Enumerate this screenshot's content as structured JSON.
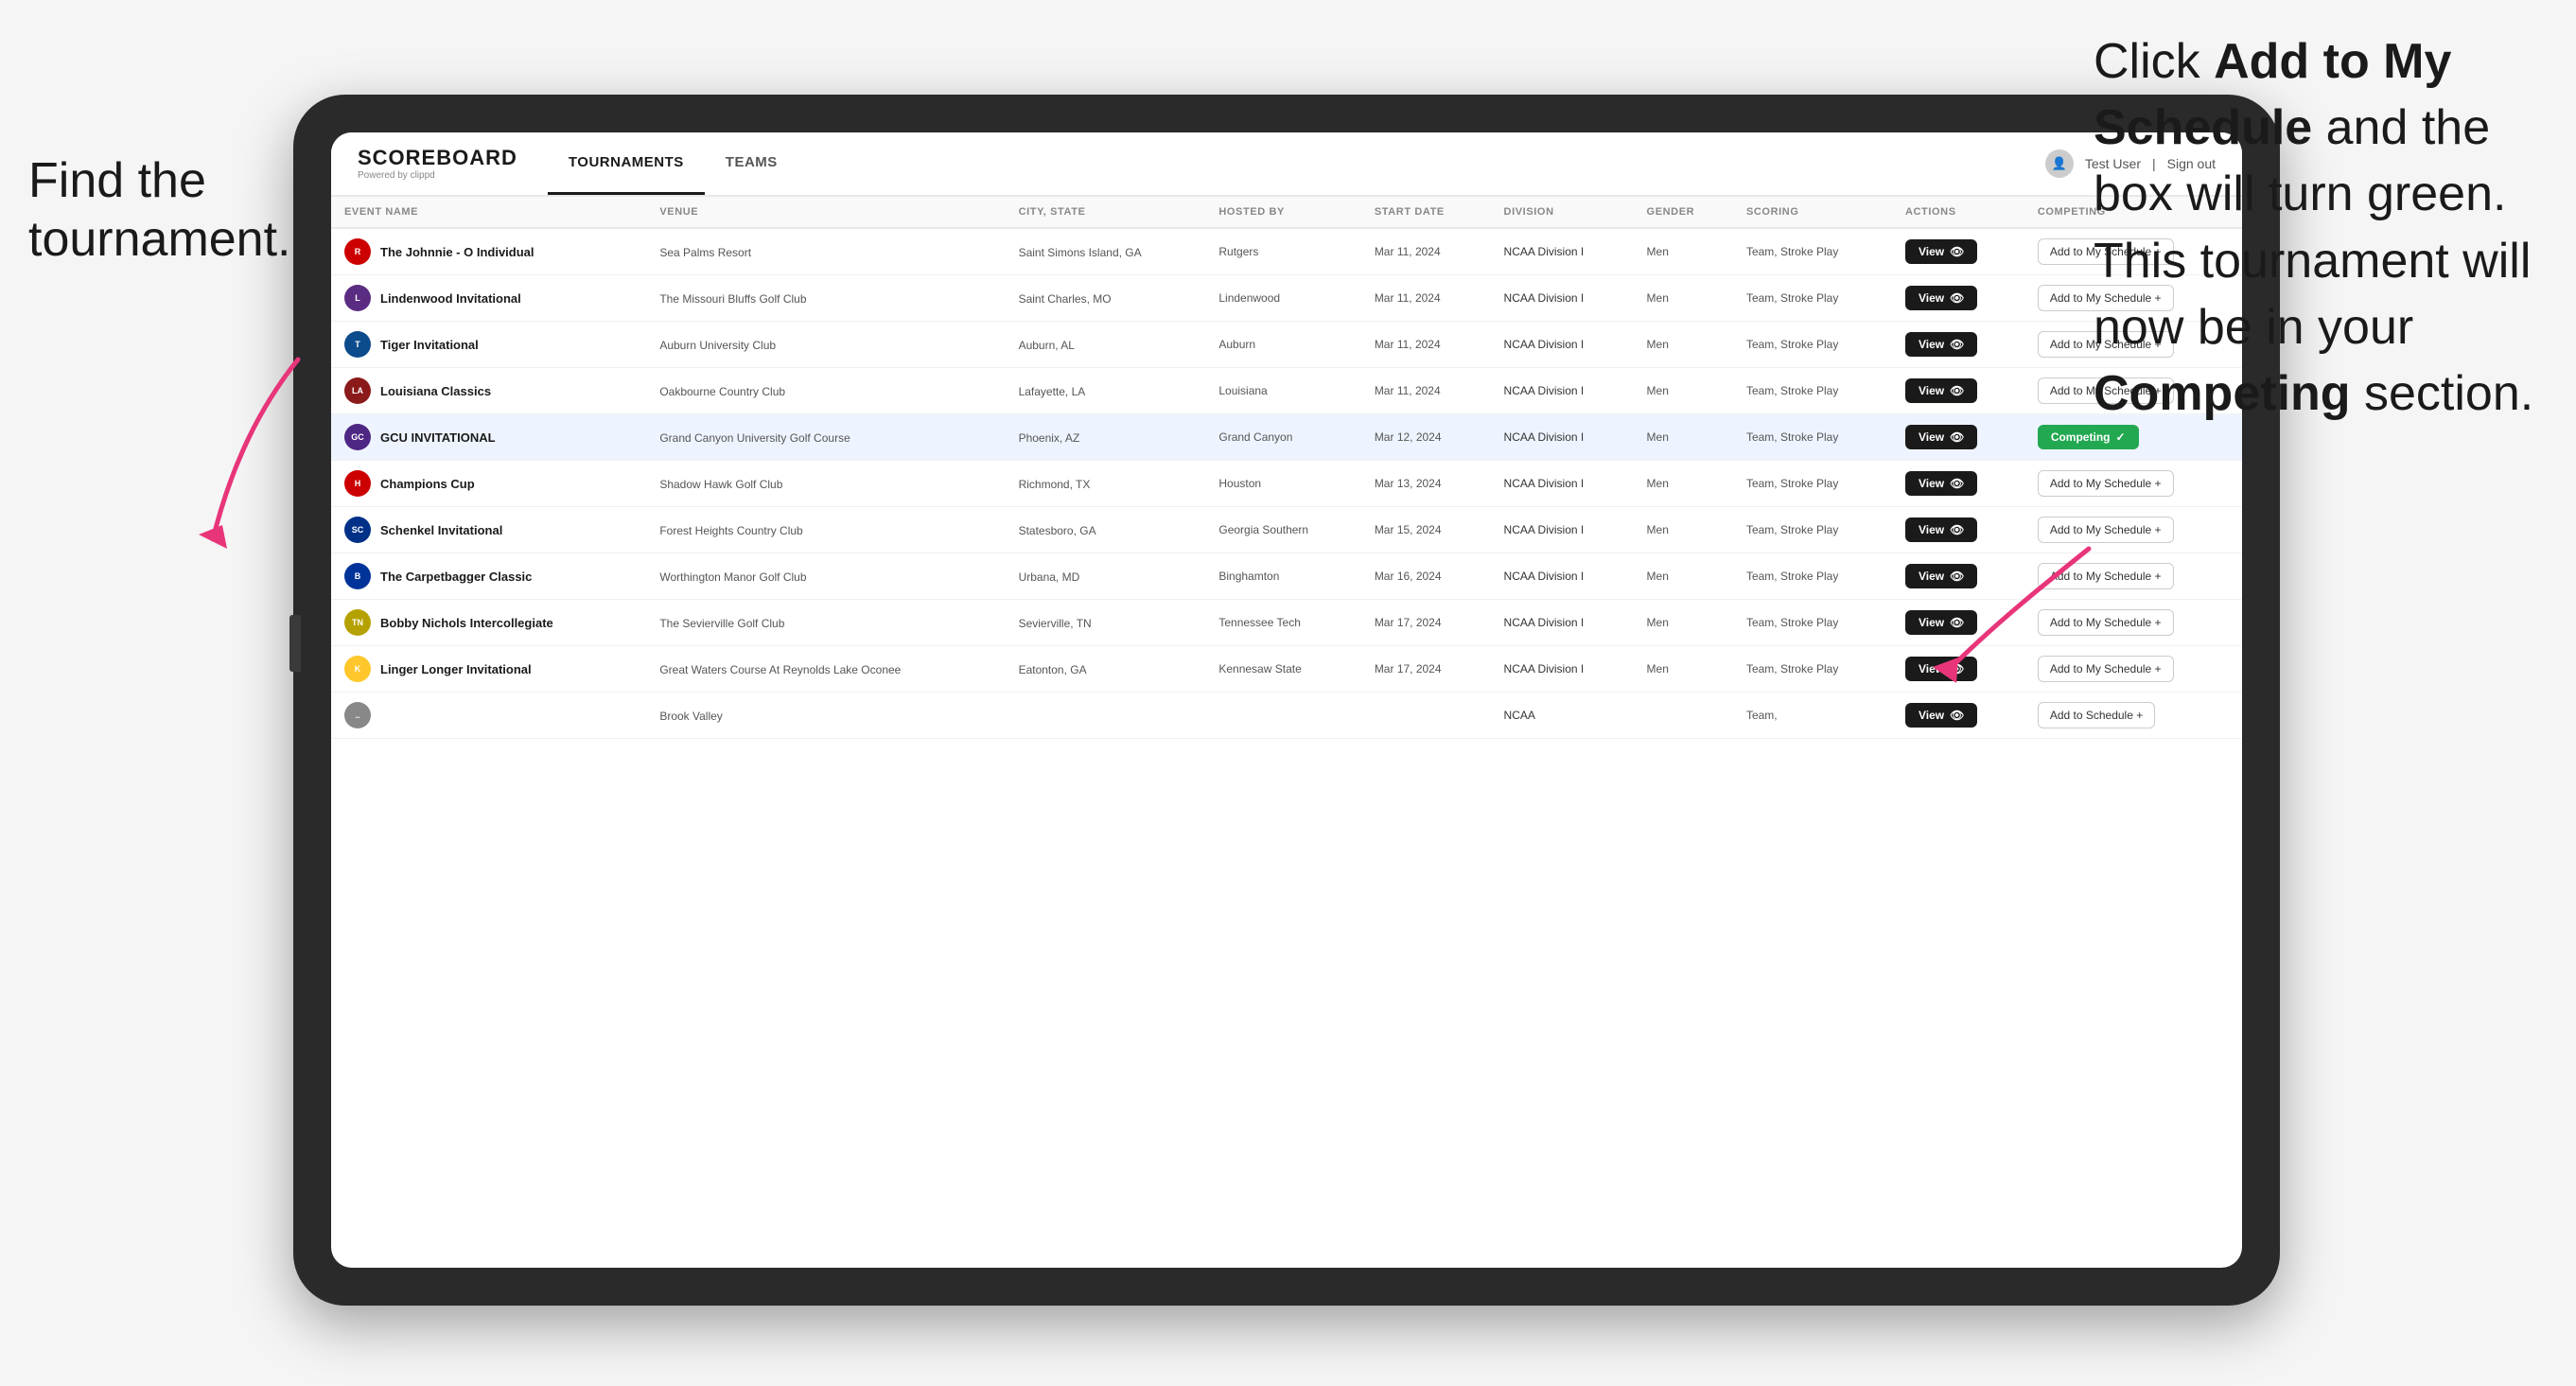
{
  "annotations": {
    "left_text_line1": "Find the",
    "left_text_line2": "tournament.",
    "right_text_html": "Click <strong>Add to My Schedule</strong> and the box will turn green. This tournament will now be in your <strong>Competing</strong> section."
  },
  "navbar": {
    "logo": "SCOREBOARD",
    "logo_sub": "Powered by clippd",
    "tabs": [
      "TOURNAMENTS",
      "TEAMS"
    ],
    "active_tab": "TOURNAMENTS",
    "user": "Test User",
    "sign_out": "Sign out"
  },
  "table": {
    "headers": [
      "EVENT NAME",
      "VENUE",
      "CITY, STATE",
      "HOSTED BY",
      "START DATE",
      "DIVISION",
      "GENDER",
      "SCORING",
      "ACTIONS",
      "COMPETING"
    ],
    "rows": [
      {
        "logo_color": "#cc0000",
        "logo_letter": "R",
        "event_name": "The Johnnie - O Individual",
        "venue": "Sea Palms Resort",
        "city_state": "Saint Simons Island, GA",
        "hosted_by": "Rutgers",
        "start_date": "Mar 11, 2024",
        "division": "NCAA Division I",
        "gender": "Men",
        "scoring": "Team, Stroke Play",
        "action": "View",
        "competing_label": "Add to My Schedule +",
        "is_competing": false,
        "highlighted": false
      },
      {
        "logo_color": "#5a2d82",
        "logo_letter": "L",
        "event_name": "Lindenwood Invitational",
        "venue": "The Missouri Bluffs Golf Club",
        "city_state": "Saint Charles, MO",
        "hosted_by": "Lindenwood",
        "start_date": "Mar 11, 2024",
        "division": "NCAA Division I",
        "gender": "Men",
        "scoring": "Team, Stroke Play",
        "action": "View",
        "competing_label": "Add to My Schedule +",
        "is_competing": false,
        "highlighted": false
      },
      {
        "logo_color": "#0c4b8c",
        "logo_letter": "T",
        "event_name": "Tiger Invitational",
        "venue": "Auburn University Club",
        "city_state": "Auburn, AL",
        "hosted_by": "Auburn",
        "start_date": "Mar 11, 2024",
        "division": "NCAA Division I",
        "gender": "Men",
        "scoring": "Team, Stroke Play",
        "action": "View",
        "competing_label": "Add to My Schedule +",
        "is_competing": false,
        "highlighted": false
      },
      {
        "logo_color": "#8b1a1a",
        "logo_letter": "LA",
        "event_name": "Louisiana Classics",
        "venue": "Oakbourne Country Club",
        "city_state": "Lafayette, LA",
        "hosted_by": "Louisiana",
        "start_date": "Mar 11, 2024",
        "division": "NCAA Division I",
        "gender": "Men",
        "scoring": "Team, Stroke Play",
        "action": "View",
        "competing_label": "Add to My Schedule +",
        "is_competing": false,
        "highlighted": false
      },
      {
        "logo_color": "#4e2683",
        "logo_letter": "GCU",
        "event_name": "GCU INVITATIONAL",
        "venue": "Grand Canyon University Golf Course",
        "city_state": "Phoenix, AZ",
        "hosted_by": "Grand Canyon",
        "start_date": "Mar 12, 2024",
        "division": "NCAA Division I",
        "gender": "Men",
        "scoring": "Team, Stroke Play",
        "action": "View",
        "competing_label": "Competing ✓",
        "is_competing": true,
        "highlighted": true
      },
      {
        "logo_color": "#cc0000",
        "logo_letter": "H",
        "event_name": "Champions Cup",
        "venue": "Shadow Hawk Golf Club",
        "city_state": "Richmond, TX",
        "hosted_by": "Houston",
        "start_date": "Mar 13, 2024",
        "division": "NCAA Division I",
        "gender": "Men",
        "scoring": "Team, Stroke Play",
        "action": "View",
        "competing_label": "Add to My Schedule +",
        "is_competing": false,
        "highlighted": false
      },
      {
        "logo_color": "#003087",
        "logo_letter": "SC",
        "event_name": "Schenkel Invitational",
        "venue": "Forest Heights Country Club",
        "city_state": "Statesboro, GA",
        "hosted_by": "Georgia Southern",
        "start_date": "Mar 15, 2024",
        "division": "NCAA Division I",
        "gender": "Men",
        "scoring": "Team, Stroke Play",
        "action": "View",
        "competing_label": "Add to My Schedule +",
        "is_competing": false,
        "highlighted": false
      },
      {
        "logo_color": "#003399",
        "logo_letter": "B",
        "event_name": "The Carpetbagger Classic",
        "venue": "Worthington Manor Golf Club",
        "city_state": "Urbana, MD",
        "hosted_by": "Binghamton",
        "start_date": "Mar 16, 2024",
        "division": "NCAA Division I",
        "gender": "Men",
        "scoring": "Team, Stroke Play",
        "action": "View",
        "competing_label": "Add to My Schedule +",
        "is_competing": false,
        "highlighted": false
      },
      {
        "logo_color": "#b5a200",
        "logo_letter": "TN",
        "event_name": "Bobby Nichols Intercollegiate",
        "venue": "The Sevierville Golf Club",
        "city_state": "Sevierville, TN",
        "hosted_by": "Tennessee Tech",
        "start_date": "Mar 17, 2024",
        "division": "NCAA Division I",
        "gender": "Men",
        "scoring": "Team, Stroke Play",
        "action": "View",
        "competing_label": "Add to My Schedule +",
        "is_competing": false,
        "highlighted": false
      },
      {
        "logo_color": "#ffc72c",
        "logo_letter": "K",
        "event_name": "Linger Longer Invitational",
        "venue": "Great Waters Course At Reynolds Lake Oconee",
        "city_state": "Eatonton, GA",
        "hosted_by": "Kennesaw State",
        "start_date": "Mar 17, 2024",
        "division": "NCAA Division I",
        "gender": "Men",
        "scoring": "Team, Stroke Play",
        "action": "View",
        "competing_label": "Add to My Schedule +",
        "is_competing": false,
        "highlighted": false
      },
      {
        "logo_color": "#888",
        "logo_letter": "...",
        "event_name": "",
        "venue": "Brook Valley",
        "city_state": "",
        "hosted_by": "",
        "start_date": "",
        "division": "NCAA",
        "gender": "",
        "scoring": "Team,",
        "action": "View",
        "competing_label": "Add to Schedule +",
        "is_competing": false,
        "highlighted": false,
        "partial": true
      }
    ]
  },
  "buttons": {
    "view_label": "View",
    "add_schedule_label": "Add to My Schedule +",
    "competing_label": "Competing ✓"
  },
  "colors": {
    "competing_green": "#22a851",
    "navbar_bg": "#ffffff",
    "table_highlight": "#eef4ff",
    "btn_dark": "#1a1a1a"
  }
}
